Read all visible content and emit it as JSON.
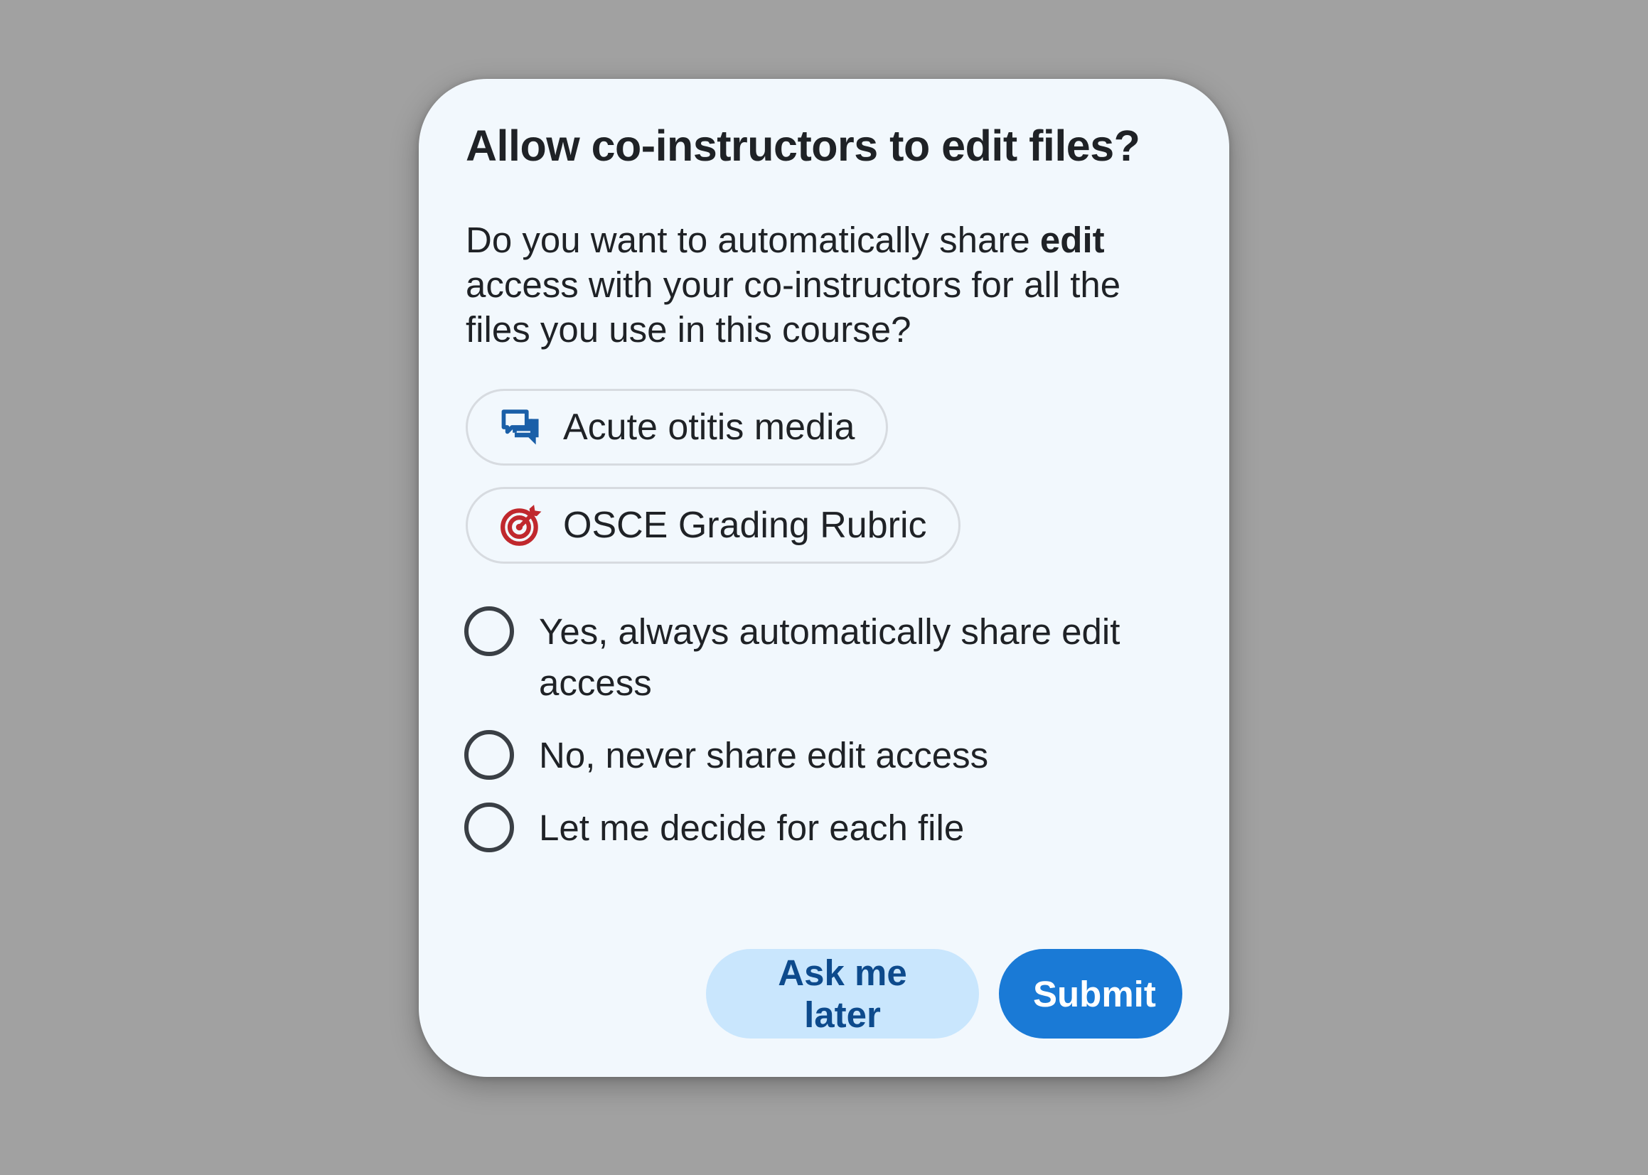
{
  "dialog": {
    "title": "Allow co-instructors to edit files?",
    "description": {
      "before": "Do you want to automatically share ",
      "bold": "edit",
      "after": " access with your co-instructors for all the files you use in this course?"
    },
    "files": [
      {
        "label": "Acute otitis media",
        "icon": "discussion-icon",
        "icon_color": "#1a5fa8"
      },
      {
        "label": "OSCE Grading Rubric",
        "icon": "target-icon",
        "icon_color": "#c0282d"
      }
    ],
    "options": [
      {
        "label": "Yes, always automatically share edit access",
        "selected": false
      },
      {
        "label": "No, never share edit access",
        "selected": false
      },
      {
        "label": "Let me decide for each file",
        "selected": false
      }
    ],
    "actions": {
      "secondary_label": "Ask me later",
      "primary_label": "Submit"
    }
  },
  "colors": {
    "backdrop": "#a1a1a1",
    "dialog_bg": "#f2f8fd",
    "primary": "#1a7ad6",
    "secondary_bg": "#c9e6fd",
    "secondary_text": "#0d4a8c"
  }
}
